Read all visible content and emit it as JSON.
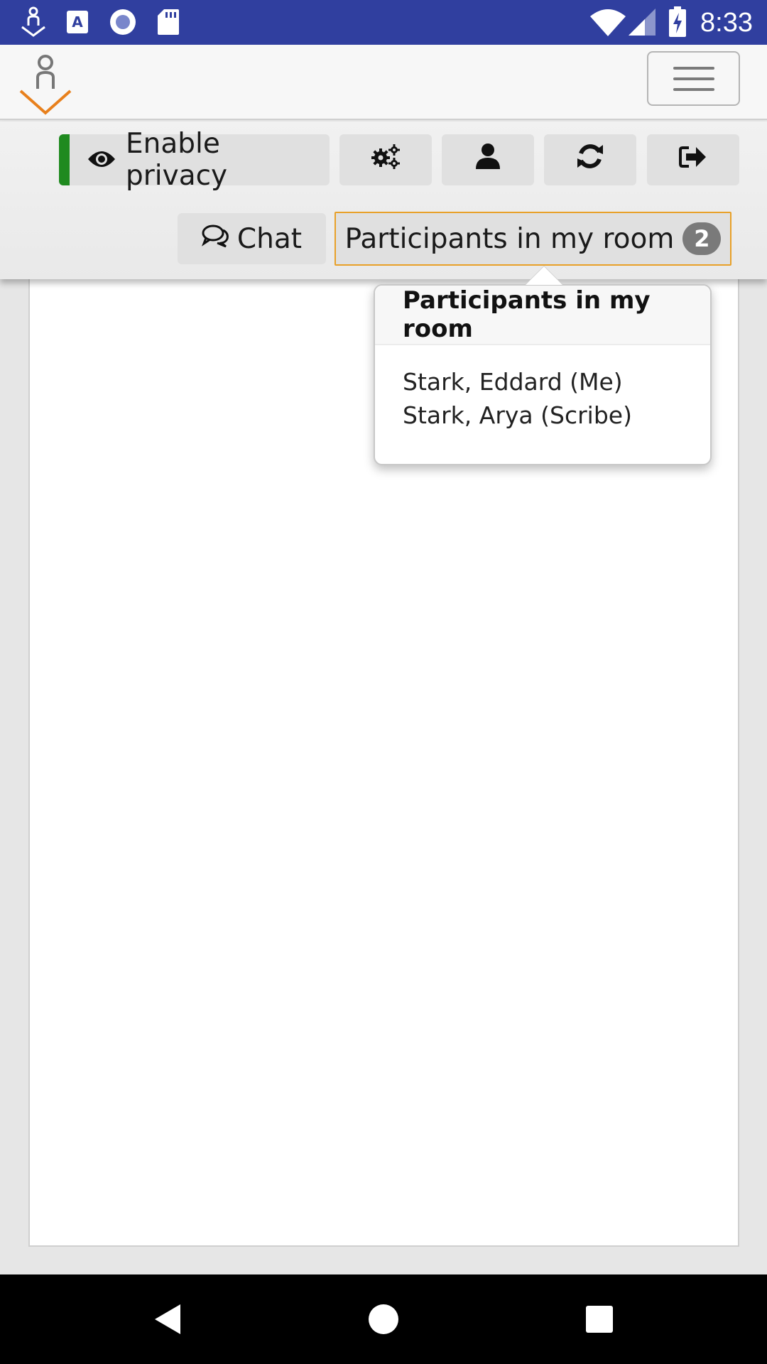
{
  "status_bar": {
    "time": "8:33",
    "icons": [
      "app-logo-icon",
      "text-a-icon",
      "record-icon",
      "sd-card-icon",
      "wifi-icon",
      "signal-icon",
      "battery-charging-icon"
    ]
  },
  "header": {
    "logo": "app-logo",
    "menu_icon": "hamburger-icon"
  },
  "toolbar": {
    "privacy_label": "Enable privacy",
    "privacy_icon": "eye-icon",
    "icon_buttons": [
      "gears-icon",
      "user-icon",
      "refresh-icon",
      "sign-out-icon"
    ],
    "chat_label": "Chat",
    "chat_icon": "comments-icon",
    "participants_label": "Participants in my room",
    "participants_count": "2"
  },
  "popover": {
    "title": "Participants in my room",
    "participants": [
      "Stark, Eddard (Me)",
      "Stark, Arya (Scribe)"
    ]
  },
  "navigation": [
    "back-icon",
    "home-icon",
    "recents-icon"
  ],
  "colors": {
    "status_bar": "#303f9f",
    "privacy_accent": "#1f8a1f",
    "participants_border": "#e8a028",
    "logo_orange": "#e8801c"
  }
}
